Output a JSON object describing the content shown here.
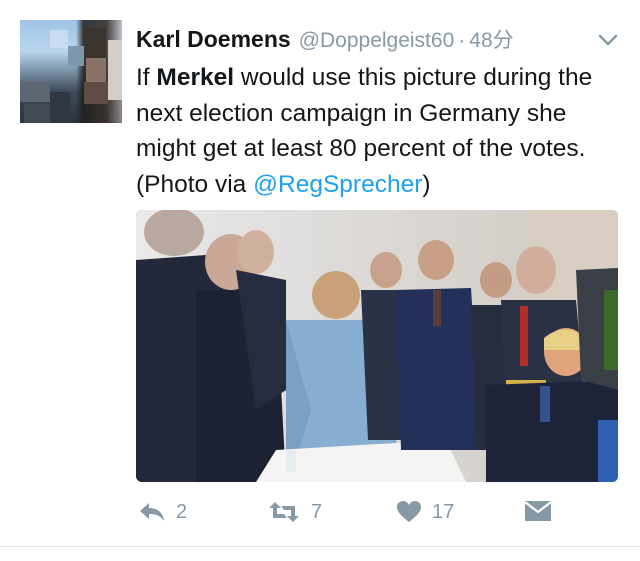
{
  "tweet": {
    "display_name": "Karl Doemens",
    "handle": "@Doppelgeist60",
    "separator": "·",
    "time": "48分",
    "text_parts": {
      "p1": "If ",
      "bold": "Merkel",
      "p2": " would use this picture during the next election campaign in Germany she might get at least 80 percent of the votes. (Photo via ",
      "mention": "@RegSprecher",
      "p3": ")"
    }
  },
  "actions": {
    "reply_count": "2",
    "retweet_count": "7",
    "like_count": "17"
  },
  "icons": [
    "caret-down-icon",
    "reply-icon",
    "retweet-icon",
    "heart-icon",
    "direct-message-icon"
  ],
  "colors": {
    "link": "#1da1f2",
    "muted": "#8899a6",
    "text": "#14171a"
  }
}
